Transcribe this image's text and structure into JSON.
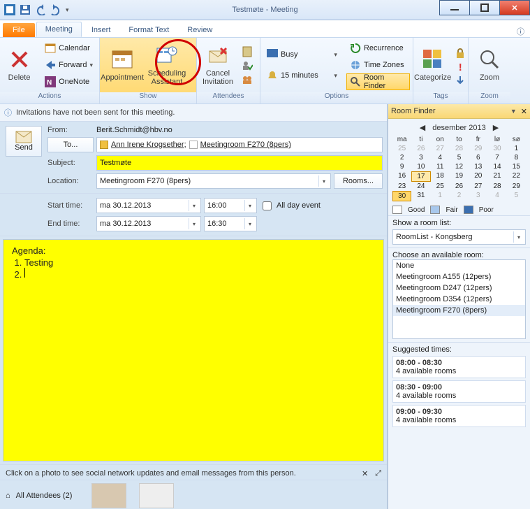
{
  "window": {
    "title": "Testmøte  -  Meeting"
  },
  "tabs": {
    "file": "File",
    "meeting": "Meeting",
    "insert": "Insert",
    "format": "Format Text",
    "review": "Review"
  },
  "ribbon": {
    "delete": "Delete",
    "calendar": "Calendar",
    "forward": "Forward",
    "onenote": "OneNote",
    "actions": "Actions",
    "appointment": "Appointment",
    "scheduling": "Scheduling\nAssistant",
    "show": "Show",
    "cancel": "Cancel\nInvitation",
    "attendees": "Attendees",
    "busy": "Busy",
    "reminder": "15 minutes",
    "recurrence": "Recurrence",
    "timezones": "Time Zones",
    "roomfinder": "Room Finder",
    "options": "Options",
    "categorize": "Categorize",
    "tags": "Tags",
    "zoom": "Zoom"
  },
  "info": "Invitations have not been sent for this meeting.",
  "form": {
    "send": "Send",
    "from_label": "From:",
    "from": "Berit.Schmidt@hbv.no",
    "to_btn": "To...",
    "to1": "Ann Irene Krogsether",
    "to2": "Meetingroom F270 (8pers)",
    "subject_label": "Subject:",
    "subject": "Testmøte",
    "location_label": "Location:",
    "location": "Meetingroom F270 (8pers)",
    "rooms_btn": "Rooms...",
    "start_label": "Start time:",
    "start_date": "ma 30.12.2013",
    "start_time": "16:00",
    "end_label": "End time:",
    "end_date": "ma 30.12.2013",
    "end_time": "16:30",
    "allday": "All day event"
  },
  "body": {
    "agenda": "Agenda:",
    "item1": "Testing"
  },
  "social": "Click on a photo to see social network updates and email messages from this person.",
  "attendees": {
    "label": "All Attendees (2)"
  },
  "rf": {
    "title": "Room Finder",
    "month": "desember 2013",
    "dow": [
      "ma",
      "ti",
      "on",
      "to",
      "fr",
      "lø",
      "sø"
    ],
    "legend": {
      "good": "Good",
      "fair": "Fair",
      "poor": "Poor"
    },
    "showlist_label": "Show a room list:",
    "roomlist": "RoomList - Kongsberg",
    "choose_label": "Choose an available room:",
    "rooms": [
      "None",
      "Meetingroom A155 (12pers)",
      "Meetingroom D247 (12pers)",
      "Meetingroom D354 (12pers)",
      "Meetingroom F270 (8pers)"
    ],
    "suggested_label": "Suggested times:",
    "slots": [
      {
        "t": "08:00 - 08:30",
        "a": "4 available rooms"
      },
      {
        "t": "08:30 - 09:00",
        "a": "4 available rooms"
      },
      {
        "t": "09:00 - 09:30",
        "a": "4 available rooms"
      }
    ]
  },
  "calendar": {
    "lead_out": [
      25,
      26,
      27,
      28,
      29,
      30,
      1
    ],
    "weeks": [
      [
        2,
        3,
        4,
        5,
        6,
        7,
        8
      ],
      [
        9,
        10,
        11,
        12,
        13,
        14,
        15
      ],
      [
        16,
        17,
        18,
        19,
        20,
        21,
        22
      ],
      [
        23,
        24,
        25,
        26,
        27,
        28,
        29
      ]
    ],
    "last": [
      30,
      31,
      1,
      2,
      3,
      4,
      5
    ],
    "today": 17,
    "selected": 30
  }
}
